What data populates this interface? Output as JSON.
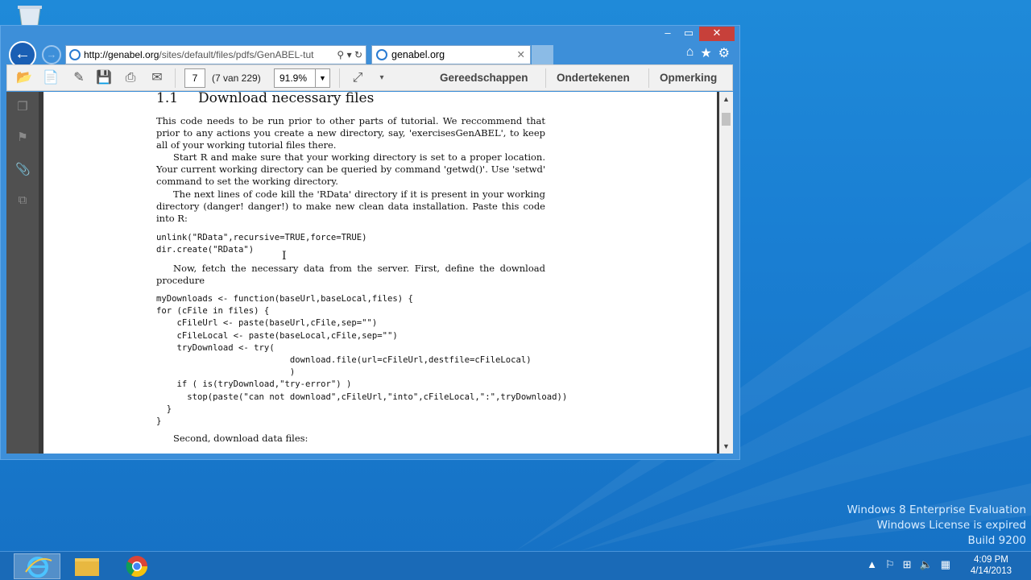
{
  "window": {
    "address_host": "http://genabel.org",
    "address_path": "/sites/default/files/pdfs/GenABEL-tut",
    "tab_title": "genabel.org"
  },
  "toolbar": {
    "page_value": "7",
    "page_count": "(7 van 229)",
    "zoom_value": "91.9%",
    "tools_label": "Gereedschappen",
    "sign_label": "Ondertekenen",
    "comment_label": "Opmerking"
  },
  "document": {
    "section_num": "1.1",
    "section_title": "Download necessary files",
    "p1": "This code needs to be run prior to other parts of tutorial.  We reccommend that prior to any actions you create a new directory, say, 'exercisesGenABEL', to keep all of your working tutorial files there.",
    "p2": "Start R and make sure that your working directory is set to a proper location. Your current working directory can be queried by command 'getwd()'.  Use 'setwd' command to set the working directory.",
    "p3": "The next lines of code kill the 'RData' directory if it is present in your working directory (danger! danger!) to make new clean data installation. Paste this code into R:",
    "code1": "unlink(\"RData\",recursive=TRUE,force=TRUE)\ndir.create(\"RData\")",
    "p4": "Now, fetch the necessary data from the server.  First, define the download procedure",
    "code2": "myDownloads <- function(baseUrl,baseLocal,files) {\nfor (cFile in files) {\n    cFileUrl <- paste(baseUrl,cFile,sep=\"\")\n    cFileLocal <- paste(baseLocal,cFile,sep=\"\")\n    tryDownload <- try(\n                          download.file(url=cFileUrl,destfile=cFileLocal)\n                          )\n    if ( is(tryDownload,\"try-error\") )\n      stop(paste(\"can not download\",cFileUrl,\"into\",cFileLocal,\":\",tryDownload))\n  }\n}",
    "p5": "Second, download data files:"
  },
  "watermark": {
    "line1": "Windows 8 Enterprise Evaluation",
    "line2": "Windows License is expired",
    "line3": "Build 9200"
  },
  "clock": {
    "time": "4:09 PM",
    "date": "4/14/2013"
  },
  "icons": {
    "accent": "#1a7fd3",
    "close_color": "#c7403a"
  }
}
